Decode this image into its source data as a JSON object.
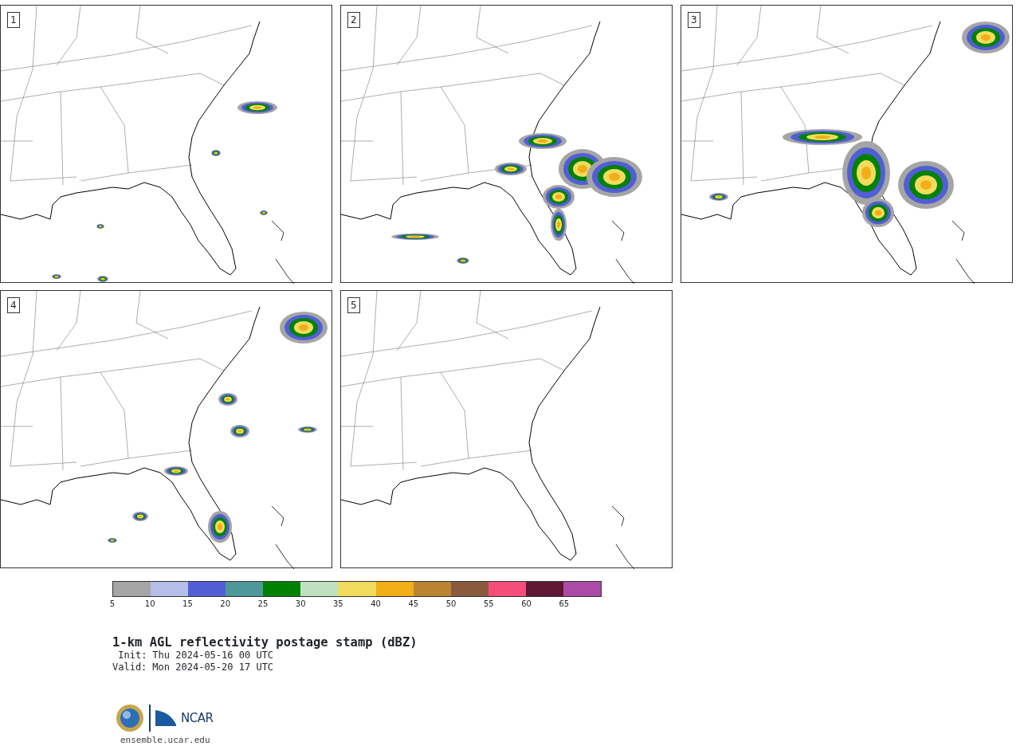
{
  "panels": [
    {
      "number": "1"
    },
    {
      "number": "2"
    },
    {
      "number": "3"
    },
    {
      "number": "4"
    },
    {
      "number": "5"
    }
  ],
  "colorbar": {
    "segments": [
      {
        "color": "#a5a5a5"
      },
      {
        "color": "#b4bee9"
      },
      {
        "color": "#515ed6"
      },
      {
        "color": "#4f9899"
      },
      {
        "color": "#008200"
      },
      {
        "color": "#bfe0c0"
      },
      {
        "color": "#f2dc5e"
      },
      {
        "color": "#f2ae17"
      },
      {
        "color": "#ba8430"
      },
      {
        "color": "#8a5a3e"
      },
      {
        "color": "#f44f7b"
      },
      {
        "color": "#5f1733"
      },
      {
        "color": "#ab4ba6"
      }
    ],
    "ticks": [
      "5",
      "10",
      "15",
      "20",
      "25",
      "30",
      "35",
      "40",
      "45",
      "50",
      "55",
      "60",
      "65"
    ]
  },
  "title": "1-km AGL reflectivity postage stamp (dBZ)",
  "times": [
    {
      "label": "Init:",
      "value": "Thu 2024-05-16 00 UTC"
    },
    {
      "label": "Valid:",
      "value": "Mon 2024-05-20 17 UTC"
    }
  ],
  "logo": {
    "org": "NCAR",
    "url": "ensemble.ucar.edu"
  }
}
